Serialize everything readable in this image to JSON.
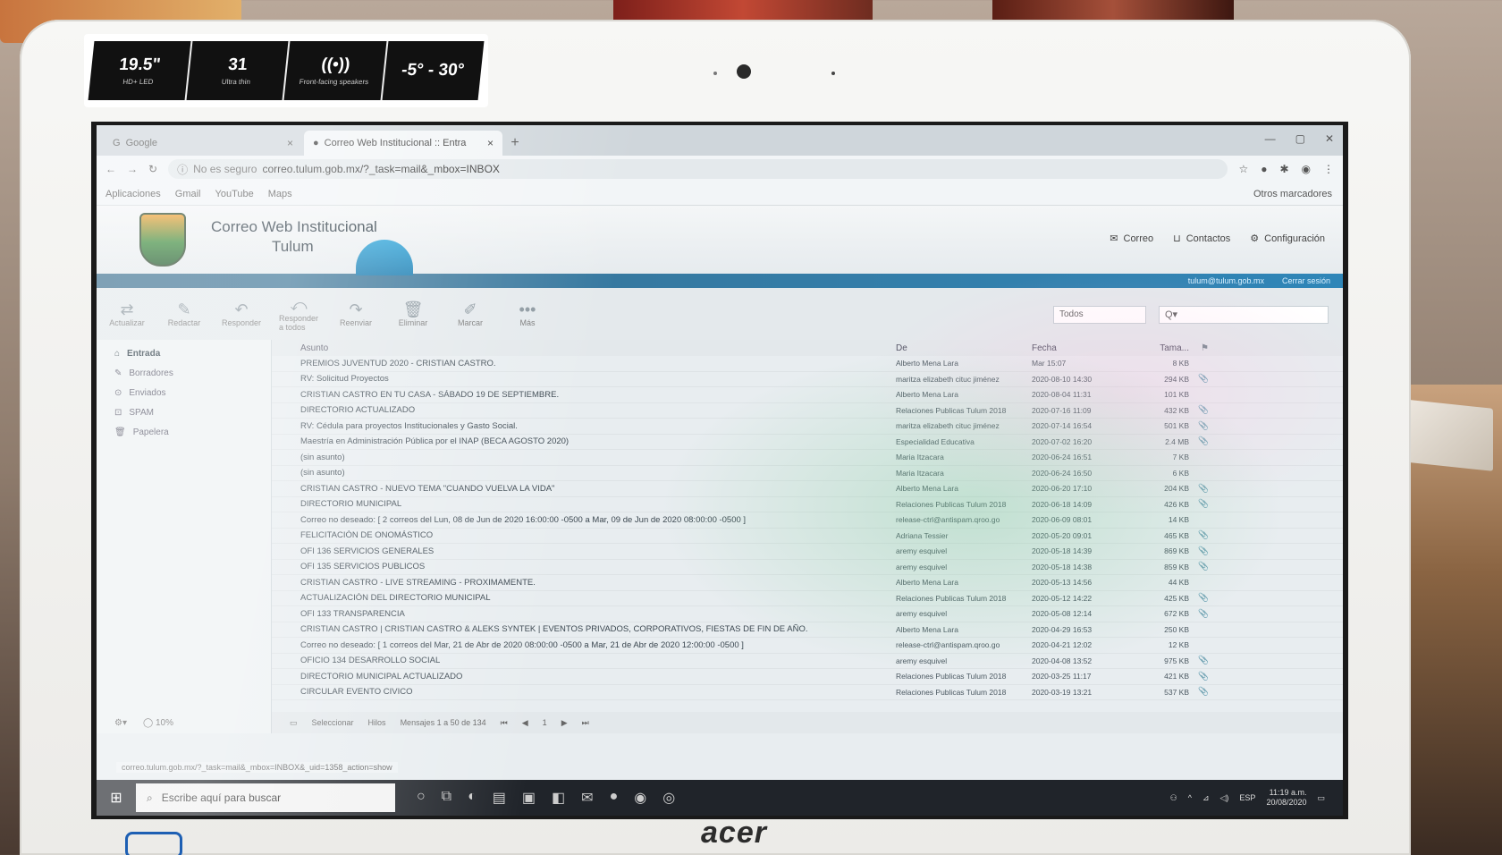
{
  "monitor": {
    "brand": "acer",
    "specs": [
      {
        "value": "19.5\"",
        "sub": "HD+ LED"
      },
      {
        "value": "31",
        "sub": "Ultra thin"
      },
      {
        "value": "((•))",
        "sub": "Front-facing speakers"
      },
      {
        "value": "-5° - 30°",
        "sub": ""
      }
    ]
  },
  "browser": {
    "tabs": [
      {
        "label": "Google",
        "icon": "G"
      },
      {
        "label": "Correo Web Institucional :: Entra",
        "icon": "●"
      }
    ],
    "new_tab": "+",
    "security": "No es seguro",
    "url": "correo.tulum.gob.mx/?_task=mail&_mbox=INBOX",
    "bookmarks": [
      "Aplicaciones",
      "Gmail",
      "YouTube",
      "Maps"
    ],
    "other_bookmarks": "Otros marcadores"
  },
  "mail": {
    "title_line1": "Correo Web Institucional",
    "title_line2": "Tulum",
    "nav": [
      "Correo",
      "Contactos",
      "Configuración"
    ],
    "user": "tulum@tulum.gob.mx",
    "logout": "Cerrar sesión",
    "actions": [
      "Actualizar",
      "Redactar",
      "Responder",
      "Responder a todos",
      "Reenviar",
      "Eliminar",
      "Marcar",
      "Más"
    ],
    "filter": "Todos",
    "search_placeholder": "Q▾",
    "folders": [
      "Entrada",
      "Borradores",
      "Enviados",
      "SPAM",
      "Papelera"
    ],
    "columns": {
      "subject": "Asunto",
      "from": "De",
      "date": "Fecha",
      "size": "Tama..."
    },
    "messages": [
      {
        "subject": "PREMIOS JUVENTUD 2020 - CRISTIAN CASTRO.",
        "from": "Alberto Mena Lara",
        "date": "Mar 15:07",
        "size": "8 KB",
        "att": ""
      },
      {
        "subject": "RV: Solicitud Proyectos",
        "from": "maritza elizabeth cituc jiménez",
        "date": "2020-08-10 14:30",
        "size": "294 KB",
        "att": "📎"
      },
      {
        "subject": "CRISTIAN CASTRO EN TU CASA - SÁBADO 19 DE SEPTIEMBRE.",
        "from": "Alberto Mena Lara",
        "date": "2020-08-04 11:31",
        "size": "101 KB",
        "att": ""
      },
      {
        "subject": "DIRECTORIO ACTUALIZADO",
        "from": "Relaciones Publicas Tulum 2018",
        "date": "2020-07-16 11:09",
        "size": "432 KB",
        "att": "📎"
      },
      {
        "subject": "RV: Cédula para proyectos Institucionales y Gasto Social.",
        "from": "maritza elizabeth cituc jiménez",
        "date": "2020-07-14 16:54",
        "size": "501 KB",
        "att": "📎"
      },
      {
        "subject": "Maestría en Administración Pública por el INAP (BECA AGOSTO 2020)",
        "from": "Especialidad Educativa",
        "date": "2020-07-02 16:20",
        "size": "2.4 MB",
        "att": "📎"
      },
      {
        "subject": "(sin asunto)",
        "from": "Maria Itzacara",
        "date": "2020-06-24 16:51",
        "size": "7 KB",
        "att": ""
      },
      {
        "subject": "(sin asunto)",
        "from": "Maria Itzacara",
        "date": "2020-06-24 16:50",
        "size": "6 KB",
        "att": ""
      },
      {
        "subject": "CRISTIAN CASTRO - NUEVO TEMA \"CUANDO VUELVA LA VIDA\"",
        "from": "Alberto Mena Lara",
        "date": "2020-06-20 17:10",
        "size": "204 KB",
        "att": "📎"
      },
      {
        "subject": "DIRECTORIO MUNICIPAL",
        "from": "Relaciones Publicas Tulum 2018",
        "date": "2020-06-18 14:09",
        "size": "426 KB",
        "att": "📎"
      },
      {
        "subject": "Correo no deseado: [ 2 correos del Lun, 08 de Jun de 2020 16:00:00 -0500 a Mar, 09 de Jun de 2020 08:00:00 -0500 ]",
        "from": "release-ctrl@antispam.qroo.go",
        "date": "2020-06-09 08:01",
        "size": "14 KB",
        "att": ""
      },
      {
        "subject": "FELICITACIÓN DE ONOMÁSTICO",
        "from": "Adriana Tessier",
        "date": "2020-05-20 09:01",
        "size": "465 KB",
        "att": "📎"
      },
      {
        "subject": "OFI 136 SERVICIOS GENERALES",
        "from": "aremy esquivel",
        "date": "2020-05-18 14:39",
        "size": "869 KB",
        "att": "📎"
      },
      {
        "subject": "OFI 135 SERVICIOS PUBLICOS",
        "from": "aremy esquivel",
        "date": "2020-05-18 14:38",
        "size": "859 KB",
        "att": "📎"
      },
      {
        "subject": "CRISTIAN CASTRO - LIVE STREAMING - PROXIMAMENTE.",
        "from": "Alberto Mena Lara",
        "date": "2020-05-13 14:56",
        "size": "44 KB",
        "att": ""
      },
      {
        "subject": "ACTUALIZACIÓN DEL DIRECTORIO MUNICIPAL",
        "from": "Relaciones Publicas Tulum 2018",
        "date": "2020-05-12 14:22",
        "size": "425 KB",
        "att": "📎"
      },
      {
        "subject": "OFI 133 TRANSPARENCIA",
        "from": "aremy esquivel",
        "date": "2020-05-08 12:14",
        "size": "672 KB",
        "att": "📎"
      },
      {
        "subject": "CRISTIAN CASTRO | CRISTIAN CASTRO & ALEKS SYNTEK | EVENTOS PRIVADOS, CORPORATIVOS, FIESTAS DE FIN DE AÑO.",
        "from": "Alberto Mena Lara",
        "date": "2020-04-29 16:53",
        "size": "250 KB",
        "att": ""
      },
      {
        "subject": "Correo no deseado: [ 1 correos del Mar, 21 de Abr de 2020 08:00:00 -0500 a Mar, 21 de Abr de 2020 12:00:00 -0500 ]",
        "from": "release-ctrl@antispam.qroo.go",
        "date": "2020-04-21 12:02",
        "size": "12 KB",
        "att": ""
      },
      {
        "subject": "OFICIO 134 DESARROLLO SOCIAL",
        "from": "aremy esquivel",
        "date": "2020-04-08 13:52",
        "size": "975 KB",
        "att": "📎"
      },
      {
        "subject": "DIRECTORIO MUNICIPAL ACTUALIZADO",
        "from": "Relaciones Publicas Tulum 2018",
        "date": "2020-03-25 11:17",
        "size": "421 KB",
        "att": "📎"
      },
      {
        "subject": "CIRCULAR EVENTO CIVICO",
        "from": "Relaciones Publicas Tulum 2018",
        "date": "2020-03-19 13:21",
        "size": "537 KB",
        "att": "📎"
      }
    ],
    "select_label": "Seleccionar",
    "threads_label": "Hilos",
    "page_info": "Mensajes 1 a 50 de 134",
    "page_number": "1",
    "quota": "10%",
    "status_url": "correo.tulum.gob.mx/?_task=mail&_mbox=INBOX&_uid=1358_action=show"
  },
  "taskbar": {
    "search_placeholder": "Escribe aquí para buscar",
    "lang": "ESP",
    "time": "11:19 a.m.",
    "date": "20/08/2020"
  }
}
